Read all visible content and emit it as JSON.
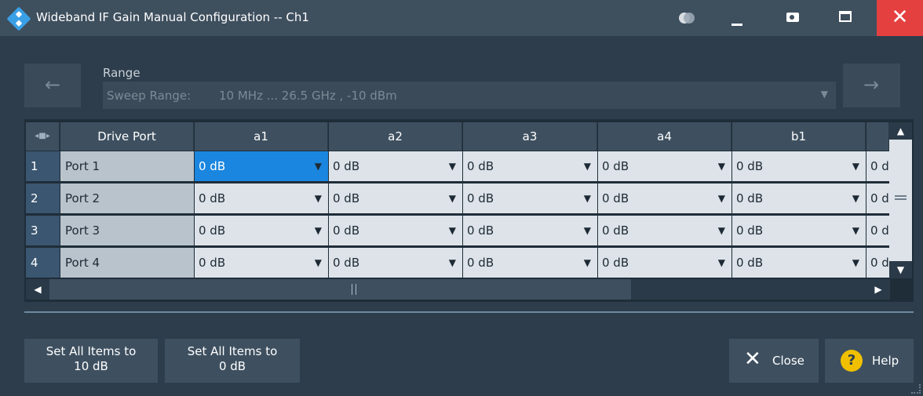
{
  "window": {
    "title": "Wideband IF Gain Manual Configuration -- Ch1"
  },
  "titlebar_icons": [
    "toggle-icon",
    "minimize-icon",
    "screenshot-icon",
    "maximize-icon",
    "close-icon"
  ],
  "range": {
    "label": "Range",
    "key": "Sweep Range:",
    "value": "10 MHz ... 26.5 GHz ,   -10 dBm",
    "prev_icon": "←",
    "next_icon": "→"
  },
  "table": {
    "headers": [
      "Drive Port",
      "a1",
      "a2",
      "a3",
      "a4",
      "b1"
    ],
    "rows": [
      {
        "num": "1",
        "port": "Port 1",
        "cells": [
          "0 dB",
          "0 dB",
          "0 dB",
          "0 dB",
          "0 dB",
          "0 d"
        ]
      },
      {
        "num": "2",
        "port": "Port 2",
        "cells": [
          "0 dB",
          "0 dB",
          "0 dB",
          "0 dB",
          "0 dB",
          "0 d"
        ]
      },
      {
        "num": "3",
        "port": "Port 3",
        "cells": [
          "0 dB",
          "0 dB",
          "0 dB",
          "0 dB",
          "0 dB",
          "0 d"
        ]
      },
      {
        "num": "4",
        "port": "Port 4",
        "cells": [
          "0 dB",
          "0 dB",
          "0 dB",
          "0 dB",
          "0 dB",
          "0 d"
        ]
      }
    ],
    "selected_cell": "row 1 / a1"
  },
  "buttons": {
    "set10_line1": "Set All Items to",
    "set10_line2": "10 dB",
    "set0_line1": "Set All Items to",
    "set0_line2": "0 dB",
    "close": "Close",
    "help": "Help"
  },
  "colors": {
    "background": "#2d3d4b",
    "titlebar": "#3e4f5e",
    "close_red": "#e54040",
    "selected_blue": "#1a86e0",
    "help_yellow": "#f0c000"
  }
}
